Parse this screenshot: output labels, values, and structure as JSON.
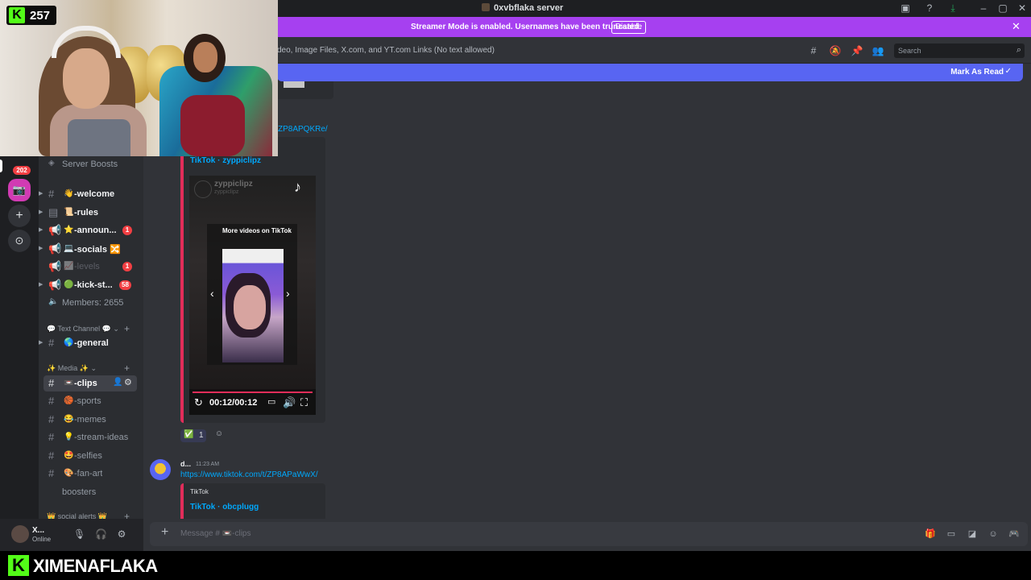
{
  "window": {
    "title": "0xvbflaka server"
  },
  "streamer_banner": {
    "message": "Streamer Mode is enabled. Usernames have been truncated.",
    "button": "Disable"
  },
  "header": {
    "topic": "deo, Image Files, X.com, and YT.com Links (No text allowed)",
    "search_placeholder": "Search"
  },
  "new_messages": {
    "mark_read": "Mark As Read"
  },
  "webcam": {
    "viewer_count": "257",
    "logo_letter": "K"
  },
  "rail": {
    "mention_badge": "202"
  },
  "channels": [
    {
      "label": "Server Boosts"
    },
    {
      "emoji": "👋",
      "label": "-welcome"
    },
    {
      "emoji": "📜",
      "label": "-rules"
    },
    {
      "emoji": "⭐",
      "label": "-announ...",
      "mentions": "1"
    },
    {
      "emoji": "💻",
      "label": "-socials",
      "extra": " 🔀"
    },
    {
      "emoji": "📈",
      "label": "-levels",
      "mentions": "1"
    },
    {
      "emoji": "🟢",
      "label": "-kick-st...",
      "mentions": "58"
    },
    {
      "label": "Members: 2655"
    },
    {
      "emoji": "🌎",
      "label": "-general"
    },
    {
      "emoji": "📼",
      "label": "-clips"
    },
    {
      "emoji": "🏀",
      "label": "-sports"
    },
    {
      "emoji": "😂",
      "label": "-memes"
    },
    {
      "emoji": "💡",
      "label": "-stream-ideas"
    },
    {
      "emoji": "🤩",
      "label": "-selfies"
    },
    {
      "emoji": "🎨",
      "label": "-fan-art"
    },
    {
      "label": "boosters"
    }
  ],
  "categories": {
    "text": "💬 Text Channel 💬",
    "media": "✨ Media ✨",
    "alerts": "👑 social alerts 👑"
  },
  "user": {
    "name": "X...",
    "status": "Online"
  },
  "chat": {
    "link_fragment": "ZP8APQKRe/",
    "embed1": {
      "provider": "",
      "title": "TikTok · zyppiclipz"
    },
    "video": {
      "channel": "zyppiclipz",
      "channel_sub": "zyppiclipz",
      "more_videos": "More videos on TikTok",
      "time": "00:12/00:12",
      "progress": 1.0
    },
    "reaction": {
      "emoji": "✅",
      "count": "1"
    },
    "msg2": {
      "username": "d...",
      "timestamp": "11:23 AM",
      "link": "https://www.tiktok.com/t/ZP8APaWwX/",
      "embed_provider": "TikTok",
      "embed_title": "TikTok · obcplugg"
    }
  },
  "composer": {
    "placeholder": "Message # 📼-clips"
  },
  "streambar": {
    "logo_letter": "K",
    "handle": "XIMENAFLAKA"
  },
  "colors": {
    "brand": "#5865f2",
    "streamer": "#a640f0",
    "kick": "#53fc18",
    "tiktok": "#e12d5a",
    "mention": "#f23f43"
  }
}
